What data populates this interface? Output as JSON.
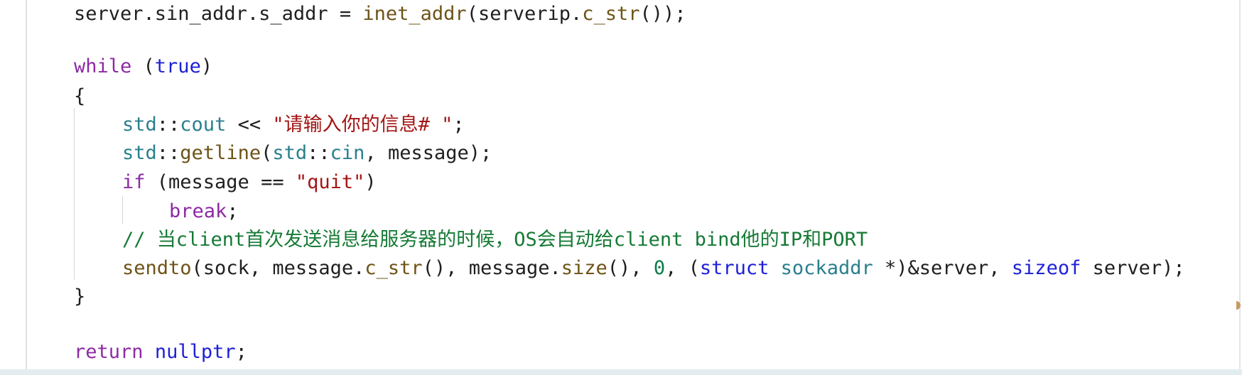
{
  "code_lines": [
    {
      "tokens": [
        {
          "t": "server.sin_addr.s_addr = ",
          "c": "txt"
        },
        {
          "t": "inet_addr",
          "c": "fn"
        },
        {
          "t": "(serverip.",
          "c": "txt"
        },
        {
          "t": "c_str",
          "c": "fn"
        },
        {
          "t": "());",
          "c": "txt"
        }
      ]
    },
    {
      "tokens": []
    },
    {
      "tokens": [
        {
          "t": "while",
          "c": "kw"
        },
        {
          "t": " (",
          "c": "txt"
        },
        {
          "t": "true",
          "c": "kwb"
        },
        {
          "t": ")",
          "c": "txt"
        }
      ]
    },
    {
      "tokens": [
        {
          "t": "{",
          "c": "txt"
        }
      ]
    },
    {
      "tokens": [
        {
          "t": "std",
          "c": "ns"
        },
        {
          "t": "::",
          "c": "txt"
        },
        {
          "t": "cout",
          "c": "ns"
        },
        {
          "t": " << ",
          "c": "txt"
        },
        {
          "t": "\"请输入你的信息# \"",
          "c": "str"
        },
        {
          "t": ";",
          "c": "txt"
        }
      ]
    },
    {
      "tokens": [
        {
          "t": "std",
          "c": "ns"
        },
        {
          "t": "::",
          "c": "txt"
        },
        {
          "t": "getline",
          "c": "fn"
        },
        {
          "t": "(",
          "c": "txt"
        },
        {
          "t": "std",
          "c": "ns"
        },
        {
          "t": "::",
          "c": "txt"
        },
        {
          "t": "cin",
          "c": "ns"
        },
        {
          "t": ", message);",
          "c": "txt"
        }
      ]
    },
    {
      "tokens": [
        {
          "t": "if",
          "c": "kw"
        },
        {
          "t": " (message == ",
          "c": "txt"
        },
        {
          "t": "\"quit\"",
          "c": "str"
        },
        {
          "t": ")",
          "c": "txt"
        }
      ]
    },
    {
      "tokens": [
        {
          "t": "break",
          "c": "kw"
        },
        {
          "t": ";",
          "c": "txt"
        }
      ]
    },
    {
      "tokens": [
        {
          "t": "// 当client首次发送消息给服务器的时候，OS会自动给client bind他的IP和PORT",
          "c": "cm"
        }
      ]
    },
    {
      "tokens": [
        {
          "t": "sendto",
          "c": "fn"
        },
        {
          "t": "(sock, message.",
          "c": "txt"
        },
        {
          "t": "c_str",
          "c": "fn"
        },
        {
          "t": "(), message.",
          "c": "txt"
        },
        {
          "t": "size",
          "c": "fn"
        },
        {
          "t": "(), ",
          "c": "txt"
        },
        {
          "t": "0",
          "c": "num"
        },
        {
          "t": ", (",
          "c": "txt"
        },
        {
          "t": "struct",
          "c": "kwb"
        },
        {
          "t": " ",
          "c": "txt"
        },
        {
          "t": "sockaddr",
          "c": "ty"
        },
        {
          "t": " *)&server, ",
          "c": "txt"
        },
        {
          "t": "sizeof",
          "c": "kwb"
        },
        {
          "t": " server);",
          "c": "txt"
        }
      ]
    },
    {
      "tokens": [
        {
          "t": "}",
          "c": "txt"
        }
      ]
    },
    {
      "tokens": []
    },
    {
      "tokens": [
        {
          "t": "return",
          "c": "kw"
        },
        {
          "t": " ",
          "c": "txt"
        },
        {
          "t": "nullptr",
          "c": "kwb"
        },
        {
          "t": ";",
          "c": "txt"
        }
      ]
    }
  ],
  "colors": {
    "keyword": "#8d2aa4",
    "keyword_blue": "#1d1fd6",
    "function": "#6d5317",
    "namespace": "#2a7f8d",
    "string": "#a31515",
    "number": "#0b7a4a",
    "comment": "#157a35",
    "text": "#1f1f1f"
  }
}
